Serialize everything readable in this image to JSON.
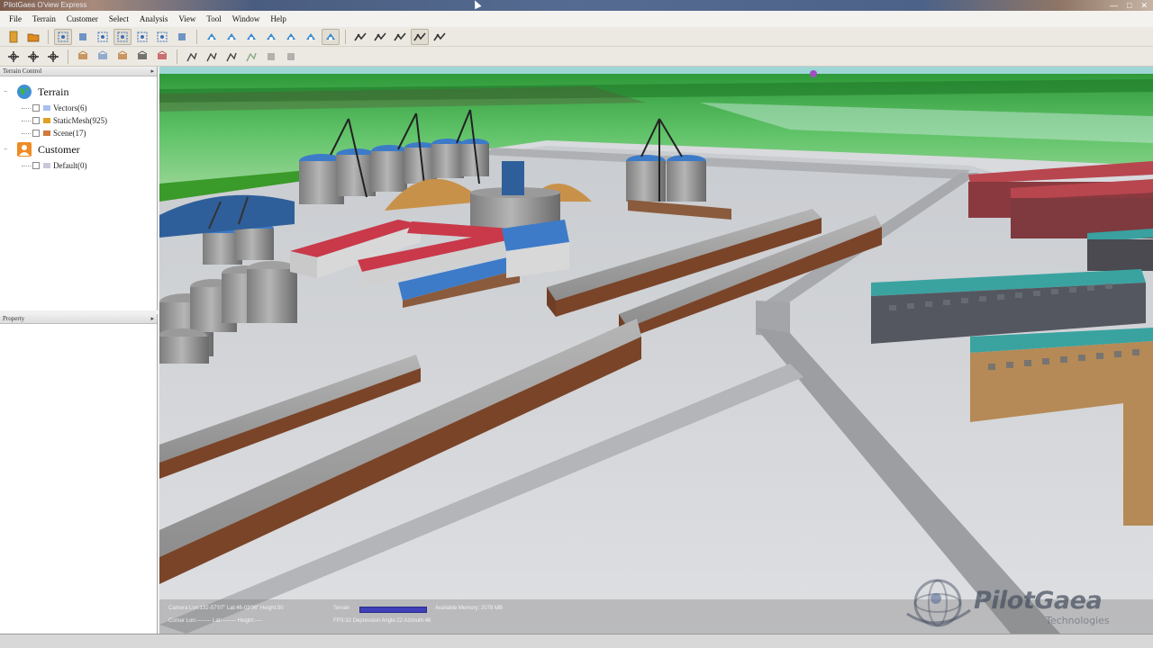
{
  "window": {
    "title": "PilotGaea O'view Express"
  },
  "menu": [
    "File",
    "Terrain",
    "Customer",
    "Select",
    "Analysis",
    "View",
    "Tool",
    "Window",
    "Help"
  ],
  "toolbar1": [
    {
      "icon": "new-file-icon",
      "color": "#e0a030"
    },
    {
      "icon": "open-folder-icon",
      "color": "#e08a20"
    },
    {
      "sep": true
    },
    {
      "icon": "select-rect-icon",
      "color": "#3a6fb8",
      "active": true
    },
    {
      "icon": "move-icon",
      "color": "#3a6fb8"
    },
    {
      "icon": "select-all-icon",
      "color": "#3a6fb8"
    },
    {
      "icon": "select-region-icon",
      "color": "#3a6fb8",
      "active": true
    },
    {
      "icon": "zoom-select-icon",
      "color": "#3a6fb8"
    },
    {
      "icon": "zoom-extent-icon",
      "color": "#3a6fb8"
    },
    {
      "icon": "fit-view-icon",
      "color": "#3a6fb8"
    },
    {
      "sep": true
    },
    {
      "icon": "nav-forward-icon",
      "color": "#3a8ad0"
    },
    {
      "icon": "nav-rotate-icon",
      "color": "#3a8ad0"
    },
    {
      "icon": "nav-pan-icon",
      "color": "#3a8ad0"
    },
    {
      "icon": "nav-fly-icon",
      "color": "#3a8ad0"
    },
    {
      "icon": "nav-walk-icon",
      "color": "#3a8ad0"
    },
    {
      "icon": "nav-orbit-icon",
      "color": "#3a8ad0"
    },
    {
      "icon": "camera-icon",
      "color": "#3a8ad0",
      "active": true
    },
    {
      "sep": true
    },
    {
      "icon": "measure-line-icon",
      "color": "#333"
    },
    {
      "icon": "measure-area-icon",
      "color": "#333"
    },
    {
      "icon": "measure-height-icon",
      "color": "#333"
    },
    {
      "icon": "measure-angle-icon",
      "color": "#333",
      "active": true
    },
    {
      "icon": "measure-path-icon",
      "color": "#333"
    }
  ],
  "toolbar2": [
    {
      "icon": "layer-add-icon",
      "color": "#2a2a2a"
    },
    {
      "icon": "layer-refresh-icon",
      "color": "#2a2a2a"
    },
    {
      "icon": "layer-settings-icon",
      "color": "#2a2a2a"
    },
    {
      "sep": true
    },
    {
      "icon": "edit-move-icon",
      "color": "#c08040"
    },
    {
      "icon": "edit-copy-icon",
      "color": "#7a9ac8"
    },
    {
      "icon": "edit-paint-icon",
      "color": "#c08040"
    },
    {
      "icon": "edit-scale-icon",
      "color": "#555"
    },
    {
      "icon": "edit-rotate-icon",
      "color": "#c05050"
    },
    {
      "sep": true
    },
    {
      "icon": "draw-line-icon",
      "color": "#444"
    },
    {
      "icon": "draw-polygon-icon",
      "color": "#444"
    },
    {
      "icon": "draw-point-icon",
      "color": "#444"
    },
    {
      "icon": "draw-curve-icon",
      "color": "#8a8"
    },
    {
      "icon": "export-icon",
      "color": "#999"
    },
    {
      "icon": "import-icon",
      "color": "#999"
    }
  ],
  "terrain_panel": {
    "header": "Terrain Control",
    "roots": [
      {
        "label": "Terrain",
        "icon": "globe-icon",
        "children": [
          {
            "label": "Vectors(6)",
            "icon": "vector-layer-icon"
          },
          {
            "label": "StaticMesh(925)",
            "icon": "mesh-layer-icon"
          },
          {
            "label": "Scene(17)",
            "icon": "scene-layer-icon"
          }
        ]
      },
      {
        "label": "Customer",
        "icon": "customer-icon",
        "children": [
          {
            "label": "Default(0)",
            "icon": "default-layer-icon"
          }
        ]
      }
    ]
  },
  "property_panel": {
    "header": "Property"
  },
  "status": {
    "camera": "Camera Lon:132-57'07\" Lat:46-03'06\" Height:50",
    "cursor": "Cursor Lon:-------- Lat:-------- Height:----",
    "terrain_label": "Terrain",
    "memory": "Available Memory: 2078 MB",
    "fps": "FPS:32  Depression Angle:22  Azimuth:46"
  },
  "logo": {
    "name": "PilotGaea",
    "sub": "Technologies"
  }
}
